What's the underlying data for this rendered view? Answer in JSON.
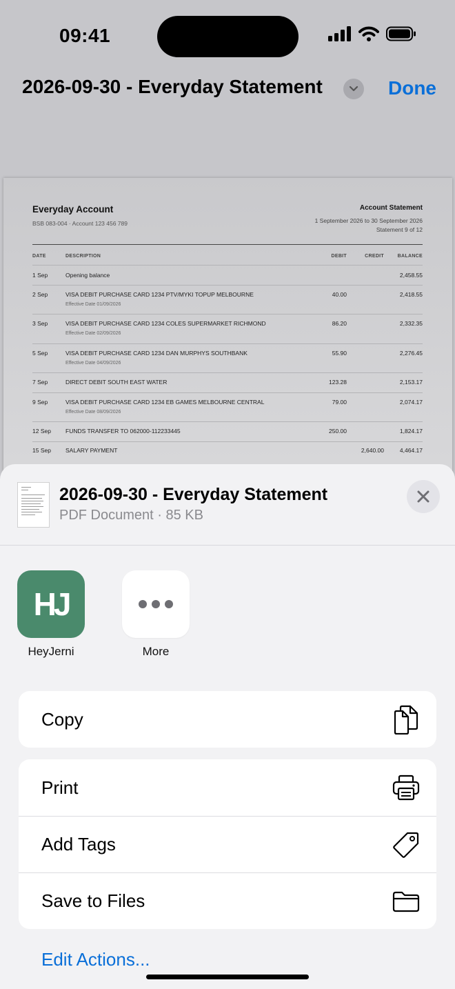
{
  "status_bar": {
    "time": "09:41",
    "icons": [
      "cellular-signal-icon",
      "wifi-icon",
      "battery-icon"
    ]
  },
  "nav": {
    "title": "2026-09-30 - Everyday Statement",
    "done_label": "Done",
    "accent_color": "#0a6fd8"
  },
  "document": {
    "account_name": "Everyday Account",
    "account_sub": "BSB 083-004 · Account 123 456 789",
    "statement_title": "Account Statement",
    "statement_period": "1 September 2026 to 30 September 2026",
    "statement_number": "Statement 9 of 12",
    "columns": [
      "DATE",
      "DESCRIPTION",
      "DEBIT",
      "CREDIT",
      "BALANCE"
    ],
    "rows": [
      {
        "date": "1 Sep",
        "description": "Opening balance",
        "sub": "",
        "debit": "",
        "credit": "",
        "balance": "2,458.55"
      },
      {
        "date": "2 Sep",
        "description": "VISA DEBIT PURCHASE CARD 1234 PTV/MYKI TOPUP MELBOURNE",
        "sub": "Effective Date 01/09/2026",
        "debit": "40.00",
        "credit": "",
        "balance": "2,418.55"
      },
      {
        "date": "3 Sep",
        "description": "VISA DEBIT PURCHASE CARD 1234 COLES SUPERMARKET RICHMOND",
        "sub": "Effective Date 02/09/2026",
        "debit": "86.20",
        "credit": "",
        "balance": "2,332.35"
      },
      {
        "date": "5 Sep",
        "description": "VISA DEBIT PURCHASE CARD 1234 DAN MURPHYS SOUTHBANK",
        "sub": "Effective Date 04/09/2026",
        "debit": "55.90",
        "credit": "",
        "balance": "2,276.45"
      },
      {
        "date": "7 Sep",
        "description": "DIRECT DEBIT SOUTH EAST WATER",
        "sub": "",
        "debit": "123.28",
        "credit": "",
        "balance": "2,153.17"
      },
      {
        "date": "9 Sep",
        "description": "VISA DEBIT PURCHASE CARD 1234 EB GAMES MELBOURNE CENTRAL",
        "sub": "Effective Date 08/09/2026",
        "debit": "79.00",
        "credit": "",
        "balance": "2,074.17"
      },
      {
        "date": "12 Sep",
        "description": "FUNDS TRANSFER TO 062000-112233445",
        "sub": "",
        "debit": "250.00",
        "credit": "",
        "balance": "1,824.17"
      },
      {
        "date": "15 Sep",
        "description": "SALARY PAYMENT",
        "sub": "",
        "debit": "",
        "credit": "2,640.00",
        "balance": "4,464.17"
      }
    ]
  },
  "share_sheet": {
    "file_name": "2026-09-30 - Everyday Statement",
    "file_meta": "PDF Document · 85 KB",
    "apps": [
      {
        "label": "HeyJerni",
        "logo_text": "HJ",
        "color": "#4a8a6c"
      },
      {
        "label": "More"
      }
    ],
    "actions_group_1": [
      {
        "label": "Copy",
        "icon": "copy-icon"
      }
    ],
    "actions_group_2": [
      {
        "label": "Print",
        "icon": "printer-icon"
      },
      {
        "label": "Add Tags",
        "icon": "tag-icon"
      },
      {
        "label": "Save to Files",
        "icon": "folder-icon"
      }
    ],
    "edit_actions_label": "Edit Actions..."
  }
}
